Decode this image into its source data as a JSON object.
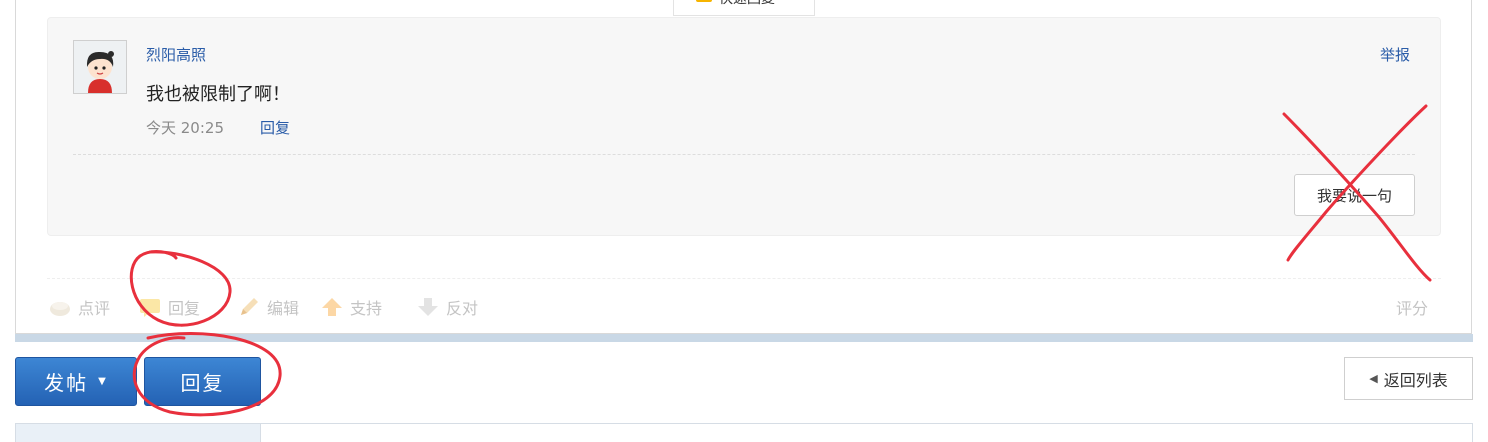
{
  "top_tab": {
    "label": "快速回复"
  },
  "comment": {
    "username": "烈阳高照",
    "report_label": "举报",
    "text": "我也被限制了啊！",
    "time": "今天 20:25",
    "reply_label": "回复",
    "say_button_label": "我要说一句"
  },
  "actions": {
    "comment_label": "点评",
    "reply_label": "回复",
    "edit_label": "编辑",
    "support_label": "支持",
    "oppose_label": "反对",
    "rate_label": "评分"
  },
  "bottom": {
    "post_label": "发帖",
    "reply_label": "回复",
    "back_label": "返回列表"
  },
  "colors": {
    "link": "#2a5ca8",
    "primary_button": "#2f74c7",
    "annotation": "#e8303d"
  }
}
